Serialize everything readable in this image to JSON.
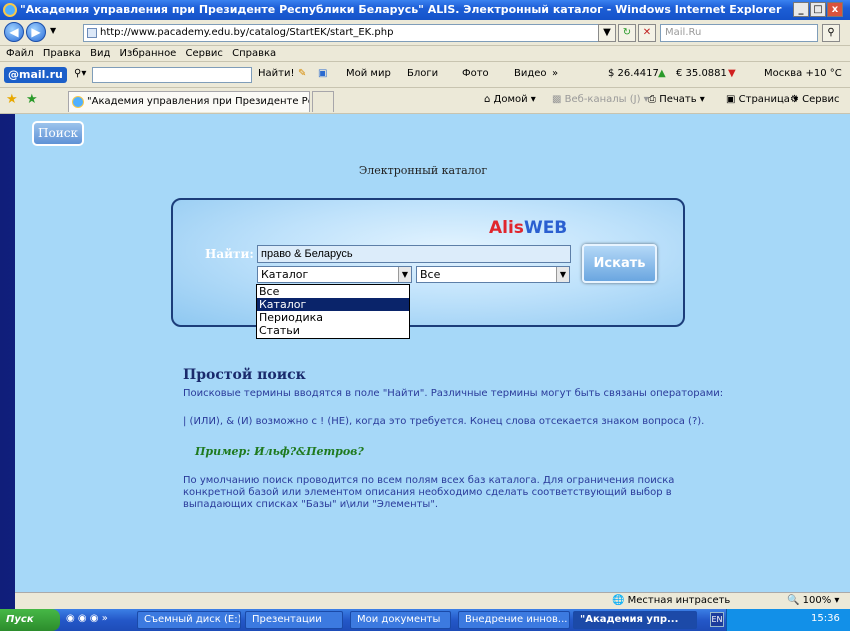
{
  "window": {
    "title": "\"Академия управления при Президенте Республики Беларусь\" ALIS. Электронный каталог  - Windows Internet Explorer",
    "minimize": "_",
    "maximize": "□",
    "close": "x"
  },
  "address": {
    "url": "http://www.pacademy.edu.by/catalog/StartEK/start_EK.php",
    "search_placeholder": "Mail.Ru"
  },
  "menu": [
    "Файл",
    "Правка",
    "Вид",
    "Избранное",
    "Сервис",
    "Справка"
  ],
  "toolbar": {
    "brand": "@mail.ru",
    "find_label": "Найти!",
    "my_world": "Мой мир",
    "blogs": "Блоги",
    "photo": "Фото",
    "video": "Видео",
    "more": "»",
    "usd": "$ 26.4417",
    "eur": "€ 35.0881",
    "weather": "Москва +10 °C"
  },
  "tabs": {
    "active_tab": "\"Академия управления при Президенте Республик...",
    "home": "Домой",
    "feeds": "Веб-каналы (J)",
    "print": "Печать",
    "page": "Страница",
    "service": "Сервис"
  },
  "page": {
    "poisk_button": "Поиск",
    "title": "Электронный каталог",
    "brand_a": "Alis",
    "brand_b": "WEB",
    "find_label": "Найти:",
    "query": "право & Беларусь",
    "base_selected": "Каталог",
    "element_selected": "Все",
    "search_button": "Искать",
    "dropdown_options": [
      "Все",
      "Каталог",
      "Периодика",
      "Статьи"
    ],
    "help_title": "Простой поиск",
    "help_p1": "Поисковые термины вводятся в поле \"Найти\". Различные термины могут быть связаны операторами:",
    "help_p2": "| (ИЛИ), & (И) возможно с ! (НЕ), когда это требуется. Конец слова отсекается знаком вопроса (?).",
    "example": "Пример: Ильф?&Петров?",
    "help_p3_l1": "По умолчанию поиск проводится по всем полям всех баз каталога. Для ограничения поиска",
    "help_p3_l2": "конкретной базой или элементом описания необходимо сделать соответствующий выбор в",
    "help_p3_l3": "выпадающих списках \"Базы\" и\\или \"Элементы\"."
  },
  "status": {
    "zone": "Местная интрасеть",
    "zoom": "100%"
  },
  "taskbar": {
    "start": "Пуск",
    "items": [
      "Съемный диск (E:)",
      "Презентации",
      "Мои документы",
      "Внедрение иннов...",
      "\"Академия упр..."
    ],
    "lang": "EN",
    "clock": "15:36"
  },
  "colors": {
    "page_bg": "#a6d8f8",
    "alis_red": "#e0262e",
    "alis_blue": "#2a5fd0",
    "highlight": "#0a246a"
  }
}
